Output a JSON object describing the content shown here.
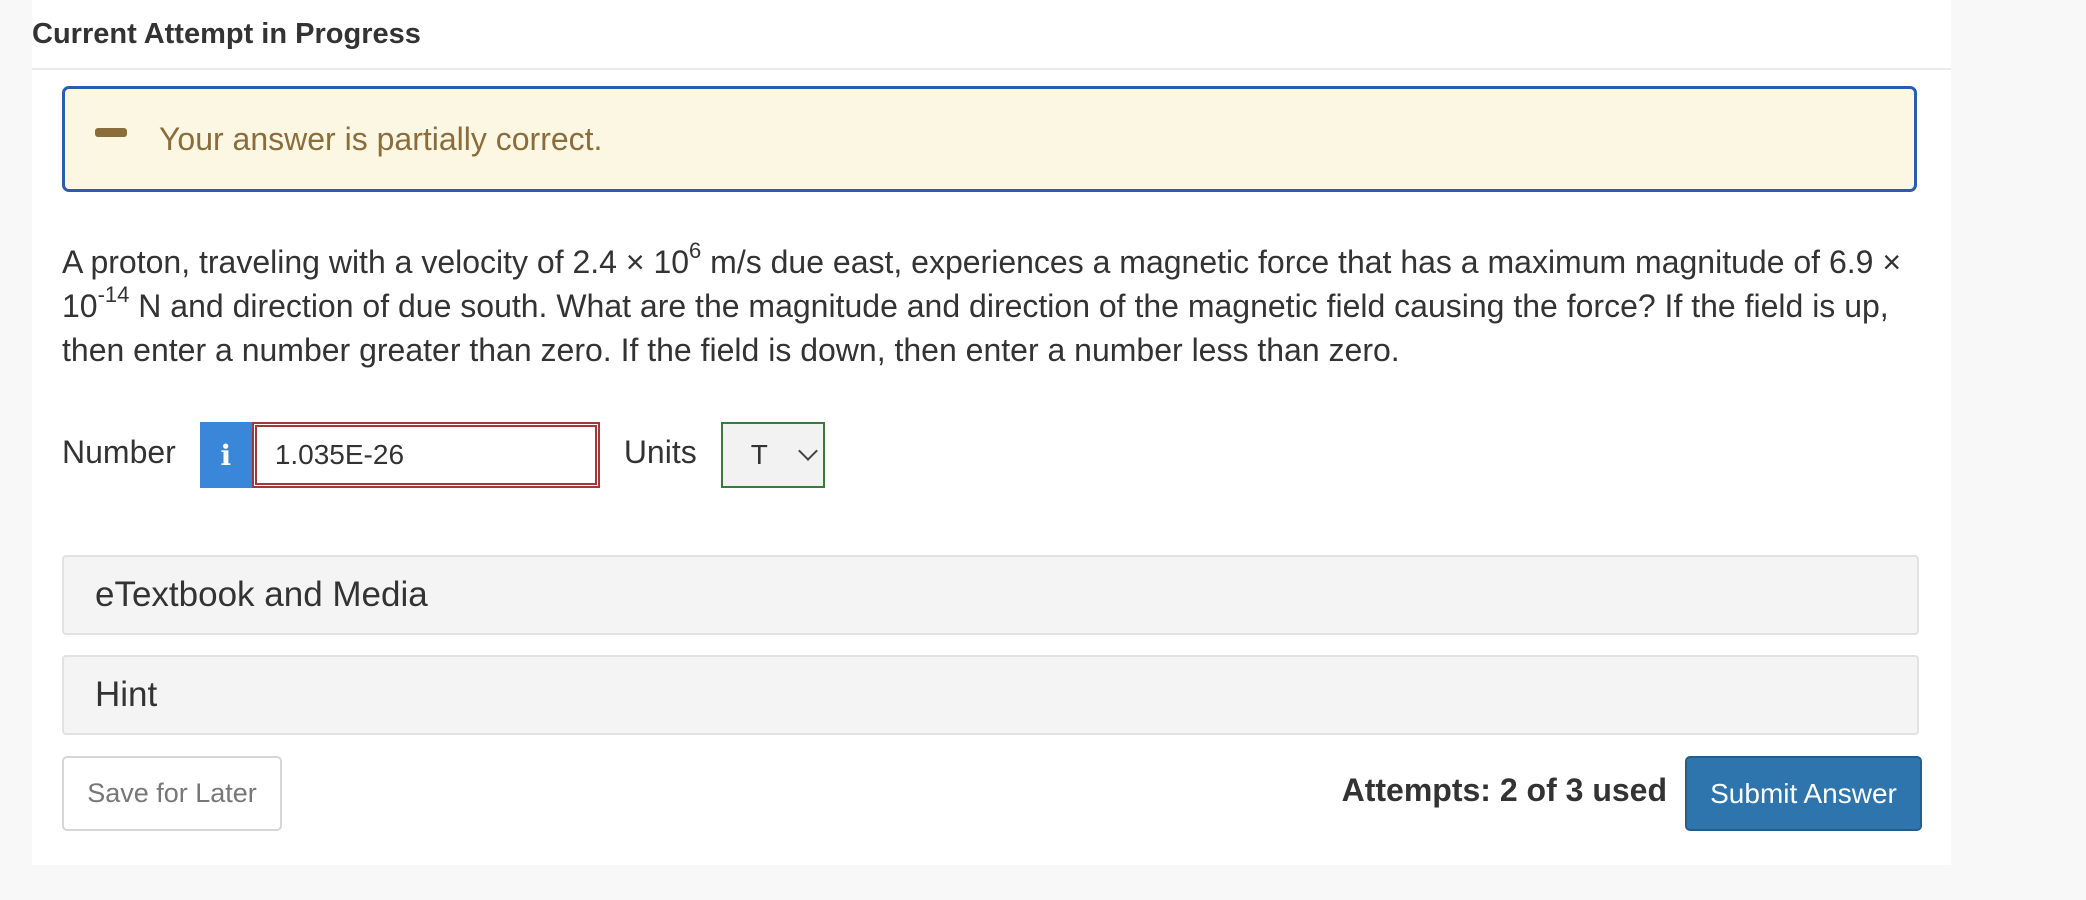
{
  "header": {
    "title": "Current Attempt in Progress"
  },
  "alert": {
    "icon": "minus-icon",
    "text": "Your answer is partially correct."
  },
  "question": {
    "part1": "A proton, traveling with a velocity of 2.4 × 10",
    "exp1": "6",
    "part2": " m/s due east, experiences a magnetic force that has a maximum magnitude of 6.9 × 10",
    "exp2": "-14",
    "part3": " N and direction of due south. What are the magnitude and direction of the magnetic field causing the force? If the field is up, then enter a number greater than zero. If the field is down, then enter a number less than zero."
  },
  "answer": {
    "number_label": "Number",
    "info_icon": "info-icon",
    "info_glyph": "i",
    "number_value": "1.035E-26",
    "units_label": "Units",
    "units_value": "T"
  },
  "sections": {
    "etextbook": "eTextbook and Media",
    "hint": "Hint"
  },
  "footer": {
    "save_label": "Save for Later",
    "attempts_text": "Attempts: 2 of 3 used",
    "submit_label": "Submit Answer"
  },
  "colors": {
    "alert_border": "#2a5db0",
    "alert_bg": "#fbf7e3",
    "alert_text": "#8a6d3b",
    "input_error_border": "#a13a34",
    "info_button": "#3a86d8",
    "submit_button": "#2f75ad"
  }
}
